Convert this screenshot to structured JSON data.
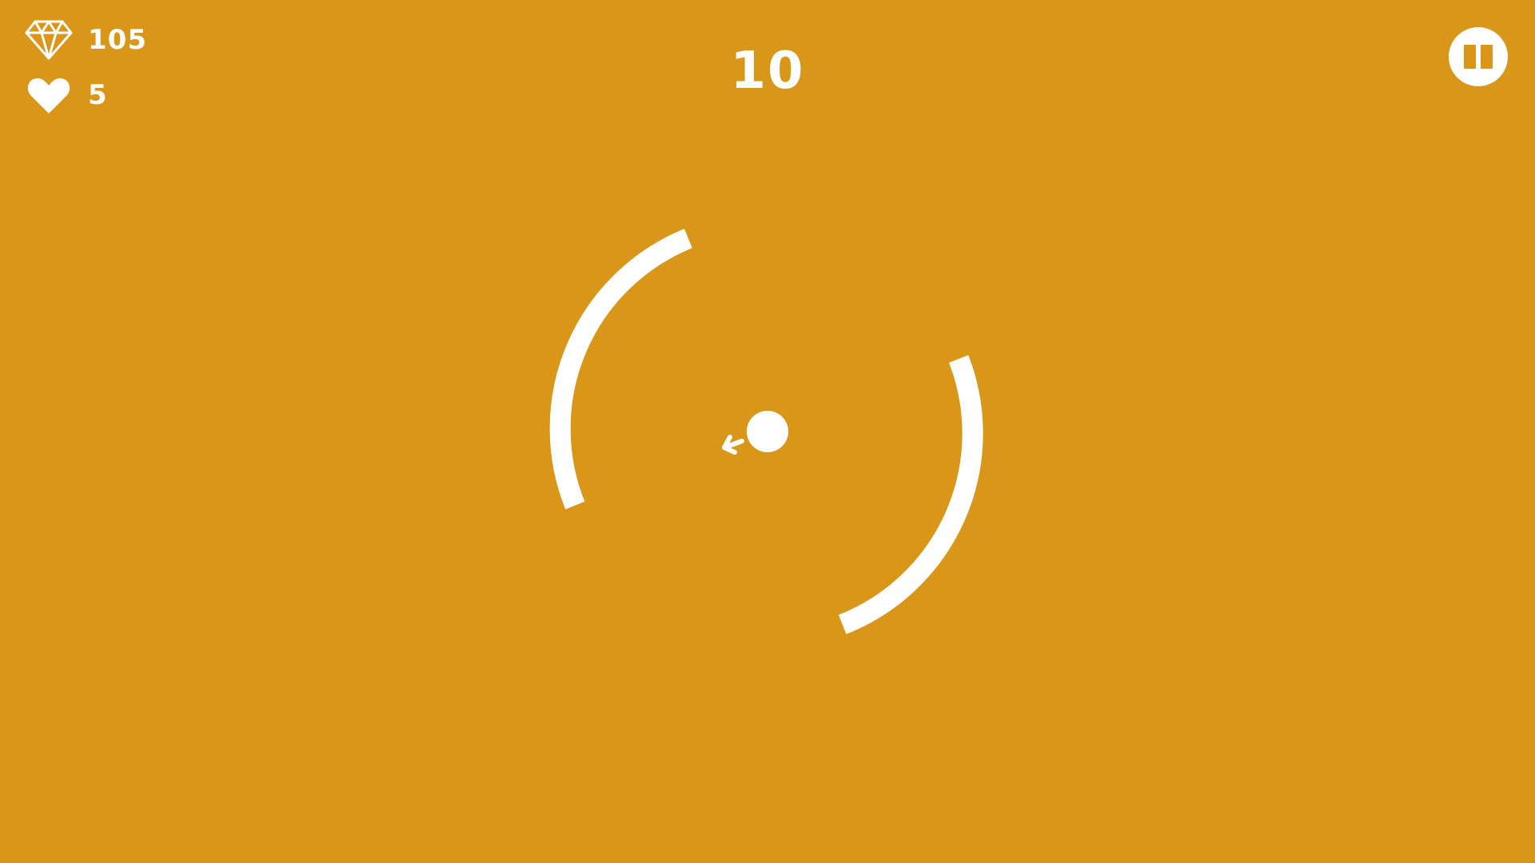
{
  "hud": {
    "gems": "105",
    "lives": "5",
    "gem_icon": "diamond-icon",
    "life_icon": "heart-icon"
  },
  "score": "10",
  "pause": {
    "icon": "pause-icon"
  },
  "colors": {
    "background": "#D99618",
    "foreground": "#FFFFFF"
  }
}
